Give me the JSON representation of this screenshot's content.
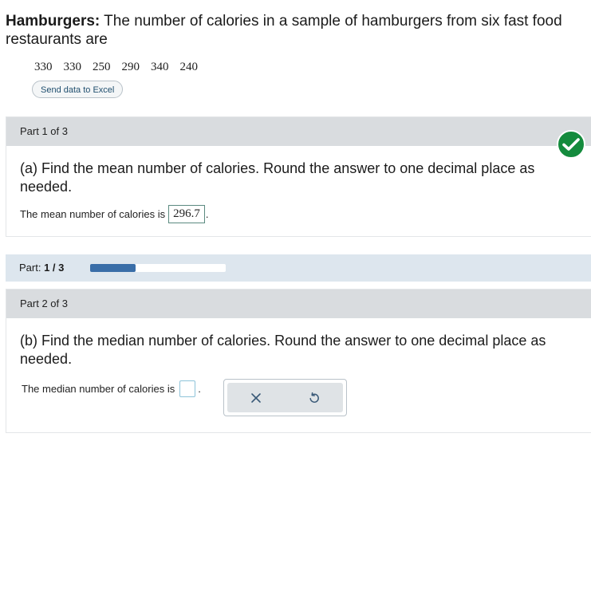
{
  "problem": {
    "title": "Hamburgers:",
    "text": " The number of calories in a sample of hamburgers from six fast food restaurants are"
  },
  "data_values": [
    "330",
    "330",
    "250",
    "290",
    "340",
    "240"
  ],
  "excel_button": "Send data to Excel",
  "part1": {
    "header": "Part 1 of 3",
    "question": "(a) Find the mean number of calories. Round the answer to one decimal place as needed.",
    "answer_prefix": "The mean number of calories is",
    "answer_value": "296.7",
    "answer_suffix": ".",
    "status_icon": "check-icon",
    "status_color": "#148b3d"
  },
  "progress": {
    "label": "Part:",
    "value_text": "1 / 3",
    "fraction": 0.333,
    "color": "#3a6ea8"
  },
  "part2": {
    "header": "Part 2 of 3",
    "question": "(b) Find the median number of calories. Round the answer to one decimal place as needed.",
    "answer_prefix": "The median number of calories is",
    "answer_value": "",
    "answer_suffix": "."
  },
  "toolbar": {
    "clear_icon": "close-icon",
    "undo_icon": "undo-icon"
  }
}
